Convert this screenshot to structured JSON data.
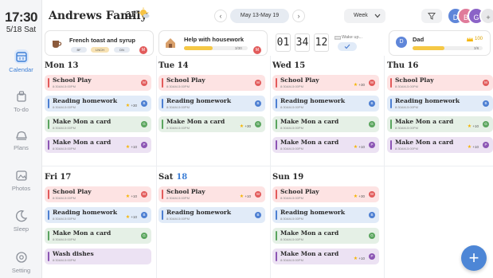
{
  "sidebar": {
    "time": "17:30",
    "date": "5/18 Sat",
    "nav": [
      {
        "label": "Calendar",
        "icon": "calendar-icon"
      },
      {
        "label": "To-do",
        "icon": "todo-icon"
      },
      {
        "label": "Plans",
        "icon": "plans-icon"
      },
      {
        "label": "Photos",
        "icon": "photos-icon"
      },
      {
        "label": "Sleep",
        "icon": "sleep-icon"
      },
      {
        "label": "Setting",
        "icon": "setting-icon"
      }
    ]
  },
  "header": {
    "title": "Andrews Family",
    "temperature": "31°",
    "range": "May 13-May 19",
    "view": "Week",
    "avatars": [
      "D",
      "B",
      "G"
    ]
  },
  "summary": {
    "meal": {
      "title": "French toast and syrup",
      "chips": [
        "BF",
        "LNCH",
        "DN"
      ],
      "avatar": "M"
    },
    "chore": {
      "title": "Help with housework",
      "progress": "3/30",
      "avatar": "M"
    },
    "clock": {
      "h": "01",
      "m": "34",
      "s": "12",
      "label": "Wake up..."
    },
    "user": {
      "name": "Dad",
      "points": "100",
      "progress": "3/6",
      "avatar": "D"
    }
  },
  "columns": [
    {
      "day": "Mon 13",
      "events": [
        {
          "name": "School Play",
          "time": "8:30AM-5:00PM",
          "color": "red",
          "dot": "M",
          "points": ""
        },
        {
          "name": "Reading homework",
          "time": "8:30AM-5:00PM",
          "color": "blue",
          "dot": "B",
          "points": "+30"
        },
        {
          "name": "Make Mon a card",
          "time": "8:30AM-5:00PM",
          "color": "green",
          "dot": "G",
          "points": ""
        },
        {
          "name": "Make Mon a card",
          "time": "8:30AM-5:00PM",
          "color": "purple",
          "dot": "P",
          "points": "+10"
        }
      ]
    },
    {
      "day": "Tue 14",
      "events": [
        {
          "name": "School Play",
          "time": "8:30AM-5:00PM",
          "color": "red",
          "dot": "M",
          "points": ""
        },
        {
          "name": "Reading homework",
          "time": "8:30AM-5:00PM",
          "color": "blue",
          "dot": "B",
          "points": ""
        },
        {
          "name": "Make Mon a card",
          "time": "8:30AM-5:00PM",
          "color": "green",
          "dot": "G",
          "points": "+30"
        }
      ]
    },
    {
      "day": "Wed 15",
      "events": [
        {
          "name": "School Play",
          "time": "8:30AM-5:00PM",
          "color": "red",
          "dot": "M",
          "points": "+30"
        },
        {
          "name": "Reading homework",
          "time": "8:30AM-5:00PM",
          "color": "blue",
          "dot": "B",
          "points": ""
        },
        {
          "name": "Make Mon a card",
          "time": "8:30AM-5:00PM",
          "color": "green",
          "dot": "G",
          "points": ""
        },
        {
          "name": "Make Mon a card",
          "time": "8:30AM-5:00PM",
          "color": "purple",
          "dot": "P",
          "points": "+10"
        }
      ]
    },
    {
      "day": "Thu 16",
      "events": [
        {
          "name": "School Play",
          "time": "8:30AM-5:00PM",
          "color": "red",
          "dot": "M",
          "points": ""
        },
        {
          "name": "Reading homework",
          "time": "8:30AM-5:00PM",
          "color": "blue",
          "dot": "B",
          "points": ""
        },
        {
          "name": "Make Mon a card",
          "time": "8:30AM-5:00PM",
          "color": "green",
          "dot": "G",
          "points": "+10"
        },
        {
          "name": "Make Mon a card",
          "time": "8:30AM-5:00PM",
          "color": "purple",
          "dot": "P",
          "points": "+10"
        }
      ]
    },
    {
      "day": "Fri 17",
      "events": [
        {
          "name": "School Play",
          "time": "8:30AM-5:00PM",
          "color": "red",
          "dot": "M",
          "points": "+10"
        },
        {
          "name": "Reading homework",
          "time": "8:30AM-5:00PM",
          "color": "blue",
          "dot": "B",
          "points": "+10"
        },
        {
          "name": "Make Mon a card",
          "time": "8:30AM-5:00PM",
          "color": "green",
          "dot": "G",
          "points": ""
        },
        {
          "name": "Wash dishes",
          "time": "8:30AM-5:00PM",
          "color": "purple",
          "dot": "",
          "points": ""
        }
      ]
    },
    {
      "day": "Sat",
      "day_num": "18",
      "events": [
        {
          "name": "School Play",
          "time": "8:30AM-5:00PM",
          "color": "red",
          "dot": "M",
          "points": "+10"
        },
        {
          "name": "Reading homework",
          "time": "8:30AM-5:00PM",
          "color": "blue",
          "dot": "B",
          "points": ""
        }
      ]
    },
    {
      "day": "Sun 19",
      "events": [
        {
          "name": "School Play",
          "time": "8:30AM-5:00PM",
          "color": "red",
          "dot": "M",
          "points": "+30"
        },
        {
          "name": "Reading homework",
          "time": "8:30AM-5:00PM",
          "color": "blue",
          "dot": "B",
          "points": ""
        },
        {
          "name": "Make Mon a card",
          "time": "8:30AM-5:00PM",
          "color": "green",
          "dot": "G",
          "points": ""
        },
        {
          "name": "Make Mon a card",
          "time": "8:30AM-5:00PM",
          "color": "purple",
          "dot": "P",
          "points": "+10"
        }
      ]
    }
  ],
  "fab": "+"
}
